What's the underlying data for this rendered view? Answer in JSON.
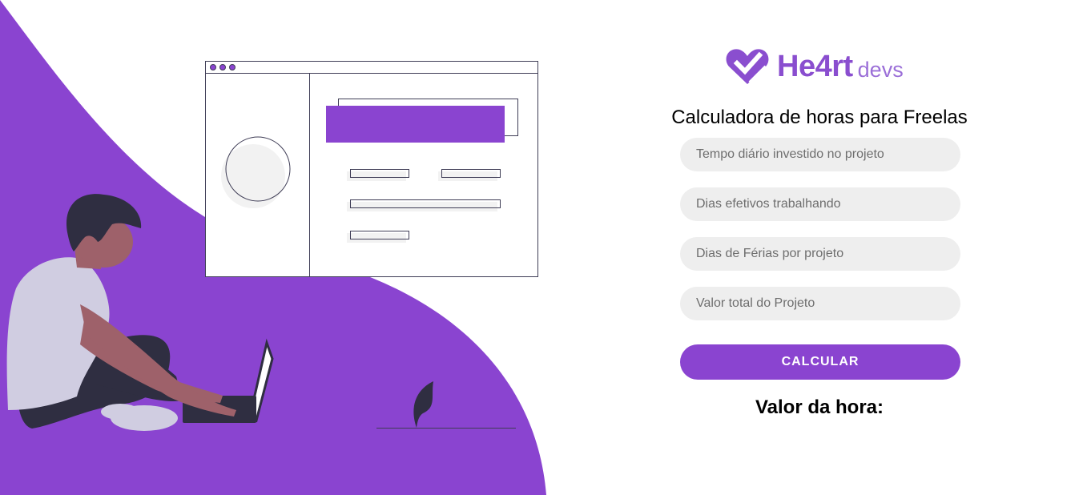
{
  "brand": {
    "name_main": "He4rt",
    "name_sub": "devs",
    "color": "#8a4ecf"
  },
  "calculator": {
    "title": "Calculadora de horas para Freelas",
    "fields": [
      {
        "placeholder": "Tempo diário investido no projeto",
        "value": ""
      },
      {
        "placeholder": "Dias efetivos trabalhando",
        "value": ""
      },
      {
        "placeholder": "Dias de Férias por projeto",
        "value": ""
      },
      {
        "placeholder": "Valor total do Projeto",
        "value": ""
      }
    ],
    "button_label": "CALCULAR",
    "result_label": "Valor da hora:"
  },
  "colors": {
    "accent": "#8a44d0",
    "field_bg": "#eeeeee",
    "dark": "#2f2e41"
  },
  "illustration": {
    "icon": "person-with-laptop-illustration"
  }
}
